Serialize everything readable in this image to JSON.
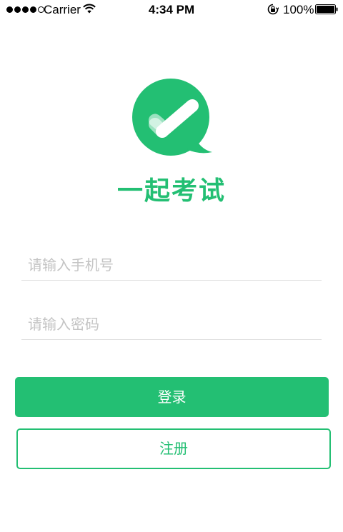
{
  "status_bar": {
    "carrier": "Carrier",
    "time": "4:34 PM",
    "battery": "100%",
    "signal_bars_filled": 4,
    "signal_bars_total": 5
  },
  "logo": {
    "icon": "checkmark-speech-bubble-icon",
    "app_name": "一起考试"
  },
  "form": {
    "phone_placeholder": "请输入手机号",
    "password_placeholder": "请输入密码"
  },
  "buttons": {
    "login_label": "登录",
    "register_label": "注册"
  },
  "colors": {
    "brand_green": "#23bf73",
    "placeholder_gray": "#c4c4c4",
    "divider_gray": "#e0e0e0"
  }
}
